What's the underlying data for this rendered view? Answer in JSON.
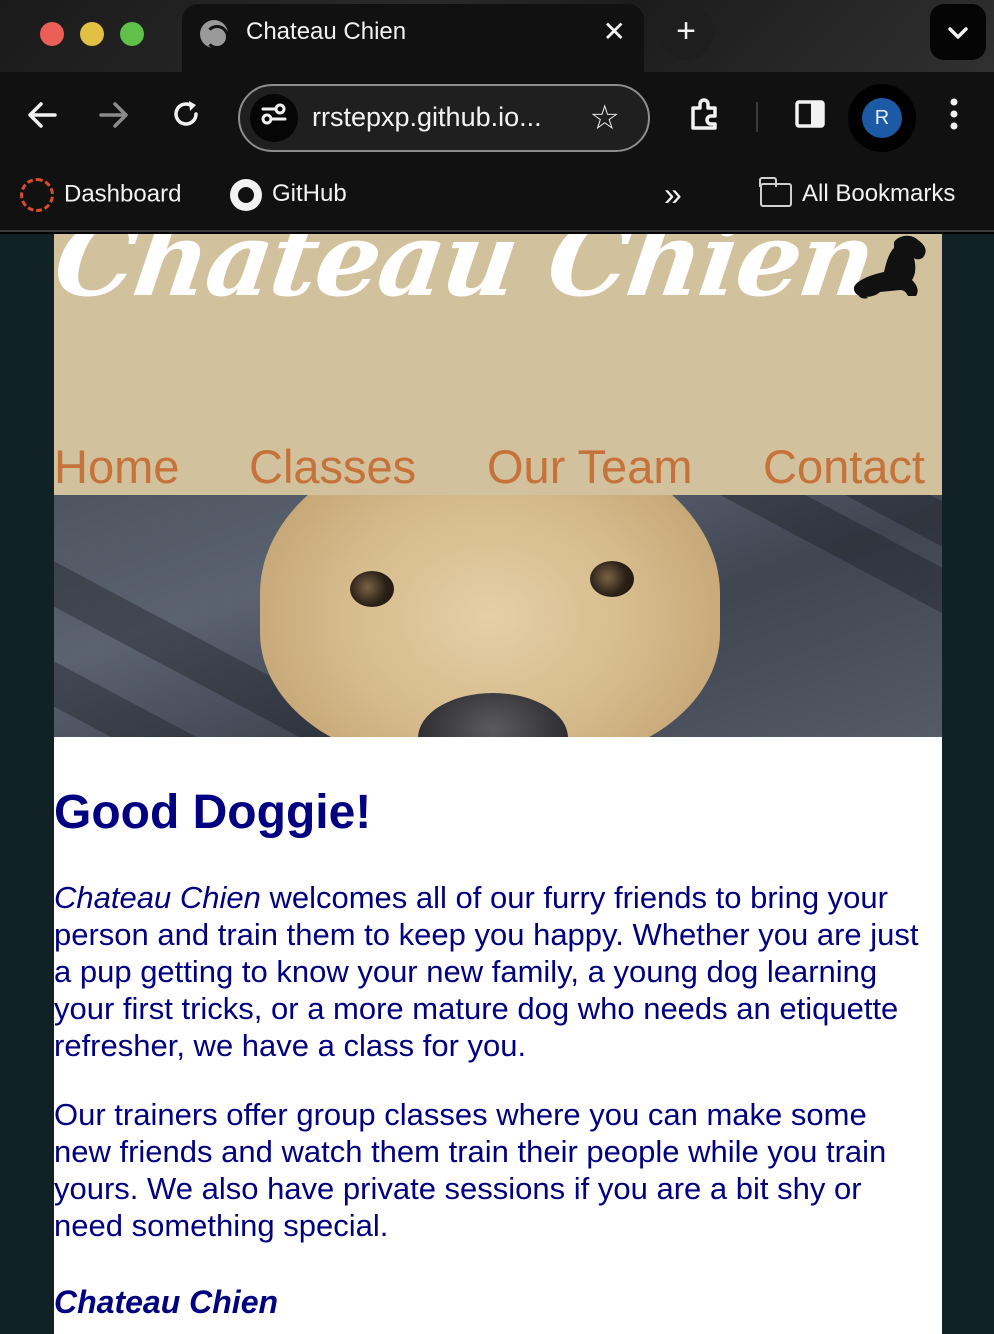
{
  "browser": {
    "tab_title": "Chateau Chien",
    "tab_close": "✕",
    "new_tab": "+",
    "url": "rrstepxp.github.io...",
    "profile_initial": "R",
    "bookmarks": [
      {
        "label": "Dashboard"
      },
      {
        "label": "GitHub"
      }
    ],
    "all_bookmarks": "All Bookmarks",
    "overflow": "»"
  },
  "site": {
    "logo": "Chateau Chien",
    "nav": [
      "Home",
      "Classes",
      "Our Team",
      "Contact"
    ],
    "heading": "Good Doggie!",
    "p1_emphasis": "Chateau Chien",
    "p1_rest": " welcomes all of our furry friends to bring your person and train them to keep you happy. Whether you are just a pup getting to know your new family, a young dog learning your first tricks, or a more mature dog who needs an etiquette refresher, we have a class for you.",
    "p2": "Our trainers offer group classes where you can make some new friends and watch them train their people while you train yours. We also have private sessions if you are a bit shy or need something special.",
    "signature": "Chateau Chien"
  },
  "colors": {
    "header_bg": "#d2c19d",
    "nav_link": "#c5723b",
    "text_navy": "#000080",
    "page_bg": "#112226"
  },
  "icons": [
    "globe-icon",
    "back-arrow-icon",
    "forward-arrow-icon",
    "reload-icon",
    "site-info-icon",
    "star-icon",
    "extensions-icon",
    "side-panel-icon",
    "menu-dots-icon",
    "canvas-icon",
    "github-icon",
    "folder-icon",
    "chevron-down-icon",
    "dog-silhouette-icon"
  ]
}
